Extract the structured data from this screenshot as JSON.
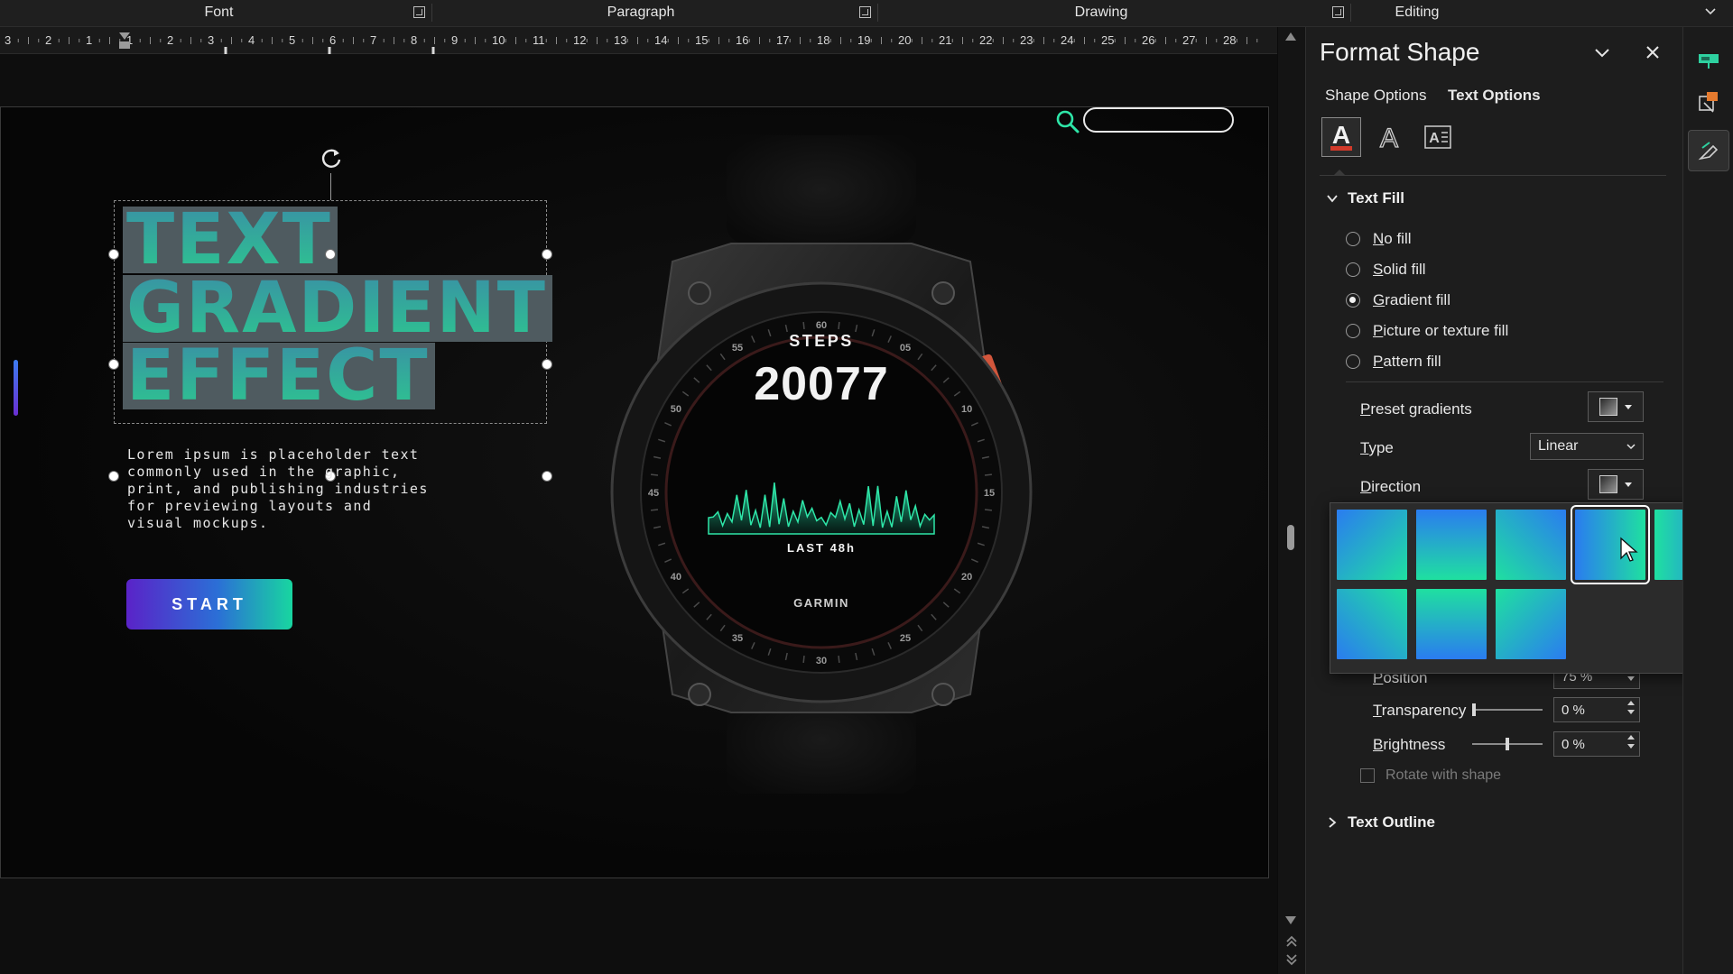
{
  "ribbon": {
    "groups": [
      {
        "label": "Font"
      },
      {
        "label": "Paragraph"
      },
      {
        "label": "Drawing"
      },
      {
        "label": "Editing"
      }
    ]
  },
  "ruler": {
    "labels": [
      "3",
      "2",
      "1",
      "1",
      "2",
      "3",
      "4",
      "5",
      "6",
      "7",
      "8",
      "9",
      "10",
      "11",
      "12",
      "13",
      "14",
      "15",
      "16",
      "17",
      "18",
      "19",
      "20",
      "21",
      "22",
      "23",
      "24",
      "25",
      "26",
      "27",
      "28"
    ]
  },
  "slide": {
    "headline": [
      "TEXT",
      "GRADIENT",
      "EFFECT"
    ],
    "body": "Lorem ipsum is placeholder text commonly used in the graphic, print, and publishing industries for previewing layouts and visual mockups.",
    "start_label": "START",
    "search_placeholder": "",
    "watch": {
      "steps_label": "STEPS",
      "steps_value": "20077",
      "period_label": "LAST 48h",
      "brand": "GARMIN",
      "bezel_numbers": [
        "60",
        "05",
        "10",
        "15",
        "20",
        "25",
        "30",
        "35",
        "40",
        "45",
        "50",
        "55"
      ],
      "accent": "#22d3a0"
    }
  },
  "pane": {
    "title": "Format Shape",
    "tabs": [
      {
        "label": "Shape Options",
        "active": false
      },
      {
        "label": "Text Options",
        "active": true
      }
    ],
    "icon_tabs": [
      "text-fill-outline-icon",
      "text-effects-icon",
      "textbox-icon"
    ],
    "text_fill": {
      "header": "Text Fill",
      "options": [
        {
          "label": "No fill",
          "checked": false
        },
        {
          "label": "Solid fill",
          "checked": false
        },
        {
          "label": "Gradient fill",
          "checked": true
        },
        {
          "label": "Picture or texture fill",
          "checked": false
        },
        {
          "label": "Pattern fill",
          "checked": false
        }
      ],
      "preset_label": "Preset gradients",
      "type_label": "Type",
      "type_value": "Linear",
      "direction_label": "Direction",
      "direction_tiles": [
        {
          "angle": "135deg",
          "selected": false
        },
        {
          "angle": "180deg",
          "selected": false
        },
        {
          "angle": "225deg",
          "selected": false
        },
        {
          "angle": "90deg",
          "selected": true
        },
        {
          "angle": "270deg",
          "selected": false
        },
        {
          "angle": "45deg",
          "selected": false
        },
        {
          "angle": "0deg",
          "selected": false
        },
        {
          "angle": "315deg",
          "selected": false
        }
      ],
      "tile_colors": [
        "#2a7cf0",
        "#1fe0a0"
      ],
      "position_label": "Position",
      "position_value": "75 %",
      "transparency_label": "Transparency",
      "transparency_value": "0 %",
      "brightness_label": "Brightness",
      "brightness_value": "0 %",
      "rotate_label": "Rotate with shape"
    },
    "text_outline": {
      "header": "Text Outline"
    }
  }
}
